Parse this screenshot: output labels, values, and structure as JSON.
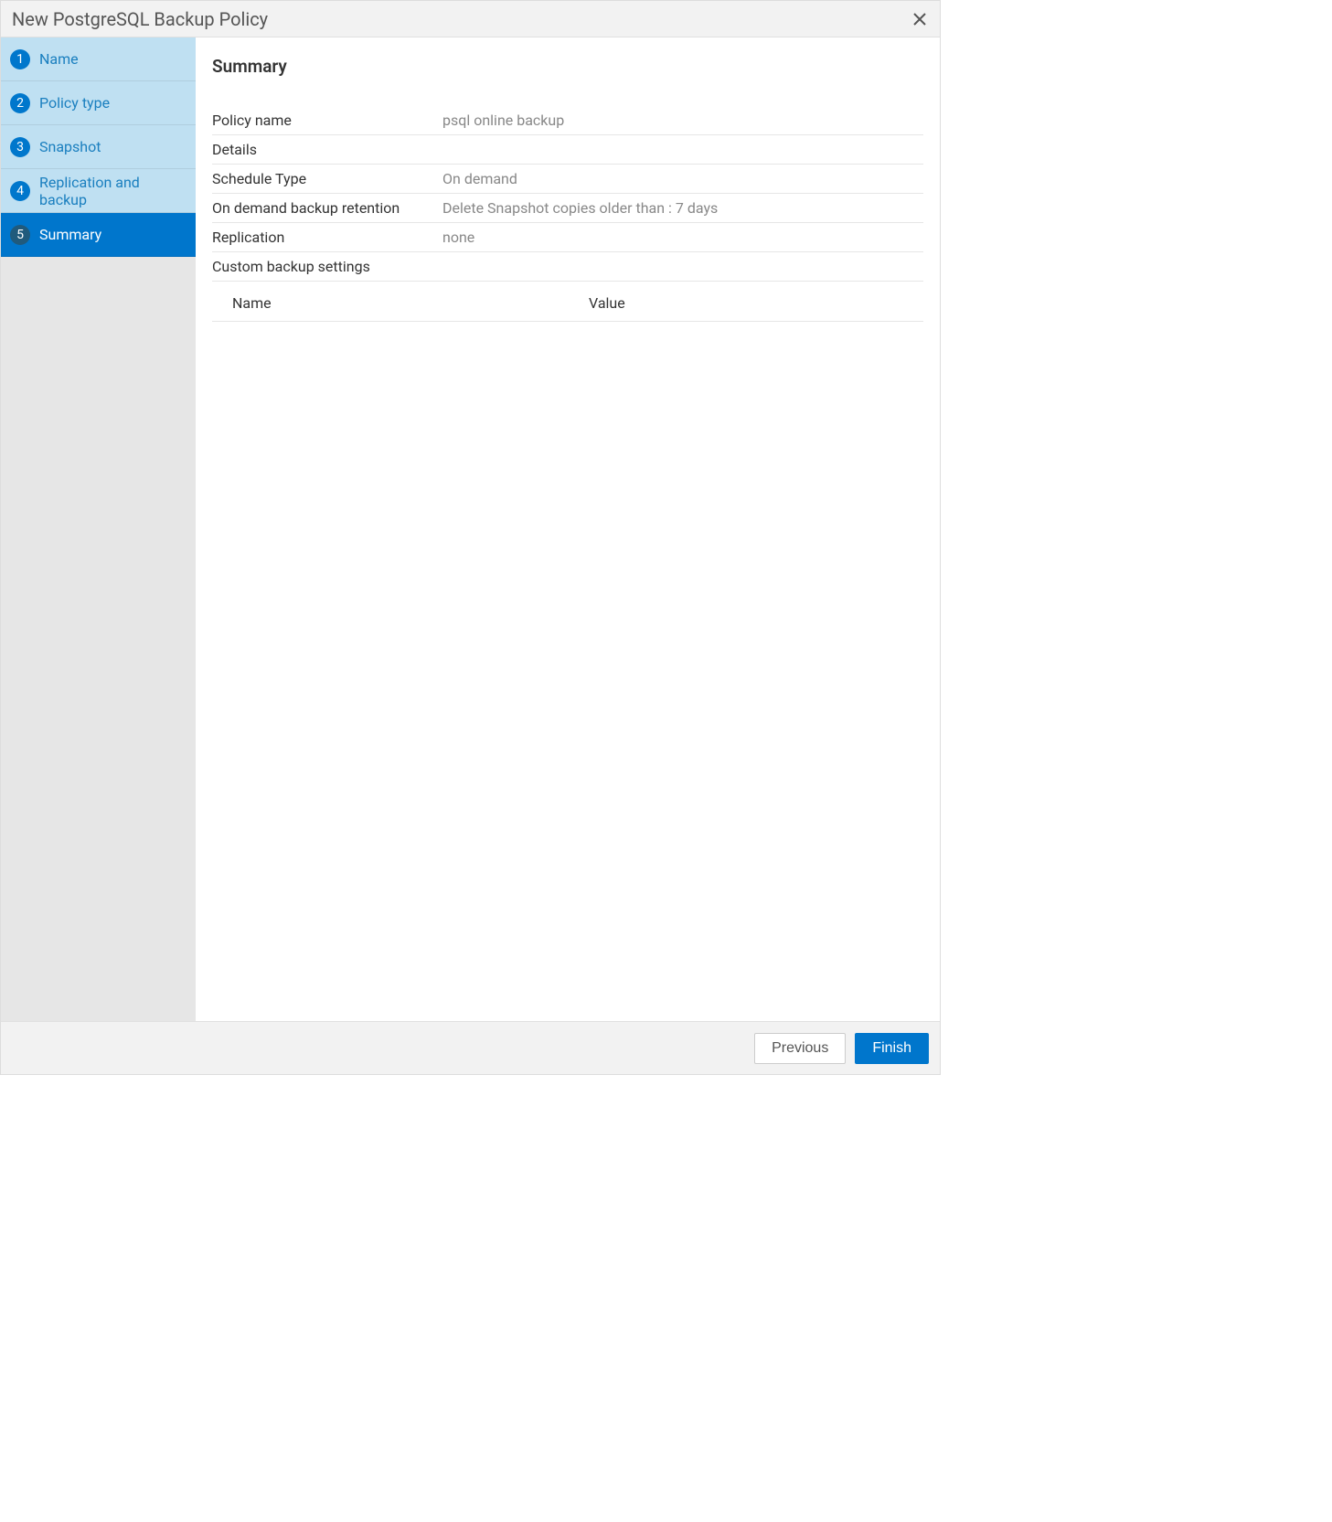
{
  "dialog": {
    "title": "New PostgreSQL Backup Policy"
  },
  "steps": [
    {
      "num": "1",
      "label": "Name"
    },
    {
      "num": "2",
      "label": "Policy type"
    },
    {
      "num": "3",
      "label": "Snapshot"
    },
    {
      "num": "4",
      "label": "Replication and backup"
    },
    {
      "num": "5",
      "label": "Summary"
    }
  ],
  "summary": {
    "heading": "Summary",
    "policy_name_label": "Policy name",
    "policy_name_value": "psql online backup",
    "details_label": "Details",
    "schedule_type_label": "Schedule Type",
    "schedule_type_value": "On demand",
    "retention_label": "On demand backup retention",
    "retention_value": "Delete Snapshot copies older than : 7 days",
    "replication_label": "Replication",
    "replication_value": "none",
    "custom_label": "Custom backup settings",
    "tbl_name": "Name",
    "tbl_value": "Value"
  },
  "footer": {
    "previous": "Previous",
    "finish": "Finish"
  }
}
